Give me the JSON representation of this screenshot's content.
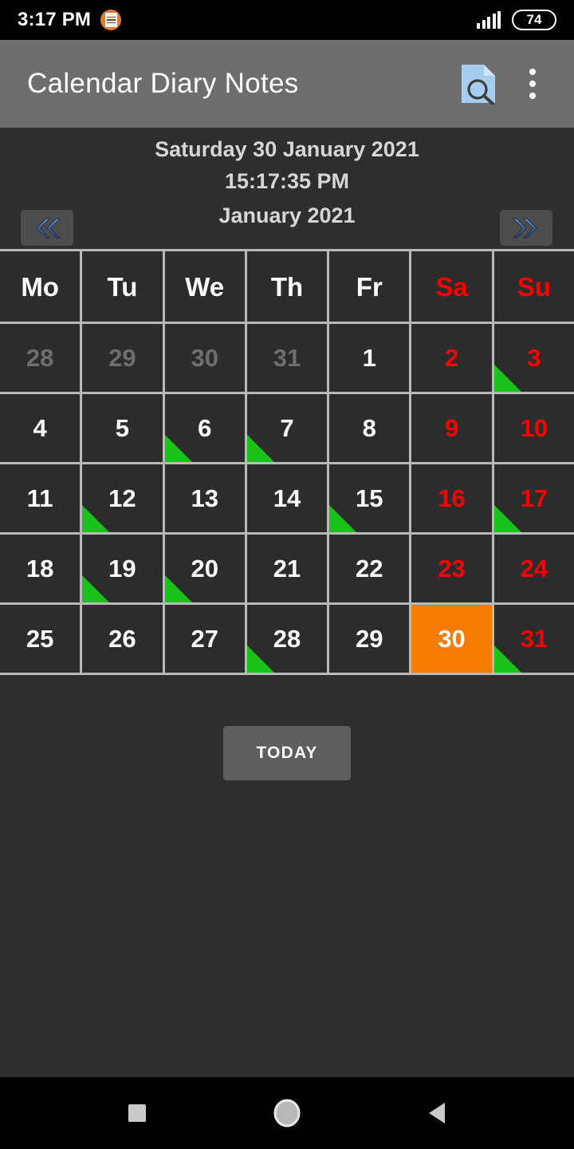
{
  "status_bar": {
    "time": "3:17 PM",
    "notification_icon": "document-notification-icon",
    "signal_icon": "cellular-signal-icon",
    "battery_level": "74"
  },
  "app_bar": {
    "title": "Calendar Diary Notes",
    "search_icon": "document-search-icon",
    "overflow_icon": "more-options-icon"
  },
  "date_panel": {
    "full_date": "Saturday 30 January 2021",
    "clock_time": "15:17:35 PM",
    "month_label": "January 2021",
    "prev_icon": "double-chevron-left-icon",
    "next_icon": "double-chevron-right-icon"
  },
  "calendar": {
    "weekday_headers": [
      {
        "label": "Mo",
        "weekend": false
      },
      {
        "label": "Tu",
        "weekend": false
      },
      {
        "label": "We",
        "weekend": false
      },
      {
        "label": "Th",
        "weekend": false
      },
      {
        "label": "Fr",
        "weekend": false
      },
      {
        "label": "Sa",
        "weekend": true
      },
      {
        "label": "Su",
        "weekend": true
      }
    ],
    "weeks": [
      [
        {
          "day": "28",
          "other_month": true,
          "weekend": false,
          "marker": false,
          "selected": false
        },
        {
          "day": "29",
          "other_month": true,
          "weekend": false,
          "marker": false,
          "selected": false
        },
        {
          "day": "30",
          "other_month": true,
          "weekend": false,
          "marker": false,
          "selected": false
        },
        {
          "day": "31",
          "other_month": true,
          "weekend": false,
          "marker": false,
          "selected": false
        },
        {
          "day": "1",
          "other_month": false,
          "weekend": false,
          "marker": false,
          "selected": false
        },
        {
          "day": "2",
          "other_month": false,
          "weekend": true,
          "marker": false,
          "selected": false
        },
        {
          "day": "3",
          "other_month": false,
          "weekend": true,
          "marker": true,
          "selected": false
        }
      ],
      [
        {
          "day": "4",
          "other_month": false,
          "weekend": false,
          "marker": false,
          "selected": false
        },
        {
          "day": "5",
          "other_month": false,
          "weekend": false,
          "marker": false,
          "selected": false
        },
        {
          "day": "6",
          "other_month": false,
          "weekend": false,
          "marker": true,
          "selected": false
        },
        {
          "day": "7",
          "other_month": false,
          "weekend": false,
          "marker": true,
          "selected": false
        },
        {
          "day": "8",
          "other_month": false,
          "weekend": false,
          "marker": false,
          "selected": false
        },
        {
          "day": "9",
          "other_month": false,
          "weekend": true,
          "marker": false,
          "selected": false
        },
        {
          "day": "10",
          "other_month": false,
          "weekend": true,
          "marker": false,
          "selected": false
        }
      ],
      [
        {
          "day": "11",
          "other_month": false,
          "weekend": false,
          "marker": false,
          "selected": false
        },
        {
          "day": "12",
          "other_month": false,
          "weekend": false,
          "marker": true,
          "selected": false
        },
        {
          "day": "13",
          "other_month": false,
          "weekend": false,
          "marker": false,
          "selected": false
        },
        {
          "day": "14",
          "other_month": false,
          "weekend": false,
          "marker": false,
          "selected": false
        },
        {
          "day": "15",
          "other_month": false,
          "weekend": false,
          "marker": true,
          "selected": false
        },
        {
          "day": "16",
          "other_month": false,
          "weekend": true,
          "marker": false,
          "selected": false
        },
        {
          "day": "17",
          "other_month": false,
          "weekend": true,
          "marker": true,
          "selected": false
        }
      ],
      [
        {
          "day": "18",
          "other_month": false,
          "weekend": false,
          "marker": false,
          "selected": false
        },
        {
          "day": "19",
          "other_month": false,
          "weekend": false,
          "marker": true,
          "selected": false
        },
        {
          "day": "20",
          "other_month": false,
          "weekend": false,
          "marker": true,
          "selected": false
        },
        {
          "day": "21",
          "other_month": false,
          "weekend": false,
          "marker": false,
          "selected": false
        },
        {
          "day": "22",
          "other_month": false,
          "weekend": false,
          "marker": false,
          "selected": false
        },
        {
          "day": "23",
          "other_month": false,
          "weekend": true,
          "marker": false,
          "selected": false
        },
        {
          "day": "24",
          "other_month": false,
          "weekend": true,
          "marker": false,
          "selected": false
        }
      ],
      [
        {
          "day": "25",
          "other_month": false,
          "weekend": false,
          "marker": false,
          "selected": false
        },
        {
          "day": "26",
          "other_month": false,
          "weekend": false,
          "marker": false,
          "selected": false
        },
        {
          "day": "27",
          "other_month": false,
          "weekend": false,
          "marker": false,
          "selected": false
        },
        {
          "day": "28",
          "other_month": false,
          "weekend": false,
          "marker": true,
          "selected": false
        },
        {
          "day": "29",
          "other_month": false,
          "weekend": false,
          "marker": false,
          "selected": false
        },
        {
          "day": "30",
          "other_month": false,
          "weekend": true,
          "marker": false,
          "selected": true
        },
        {
          "day": "31",
          "other_month": false,
          "weekend": true,
          "marker": true,
          "selected": false
        }
      ]
    ]
  },
  "today_button": {
    "label": "TODAY"
  },
  "nav_bar": {
    "recents_icon": "recents-square-icon",
    "home_icon": "home-circle-icon",
    "back_icon": "back-triangle-icon"
  },
  "colors": {
    "accent_selected": "#f57c00",
    "weekend_text": "#fa0000",
    "event_marker": "#18c218",
    "app_bar": "#6e6e6e",
    "background": "#2e2e2e",
    "grid_line": "#b9b9b9"
  }
}
